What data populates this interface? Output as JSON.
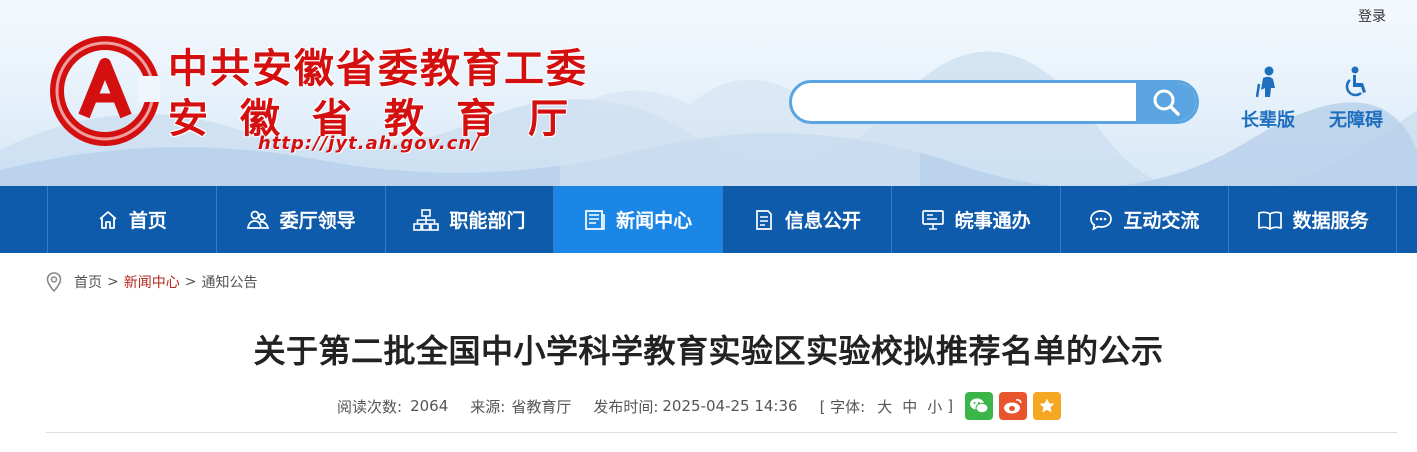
{
  "header": {
    "login_label": "登录",
    "org_name_line1": "中共安徽省委教育工委",
    "org_name_line2": "安徽省教育厅",
    "site_url": "http://jyt.ah.gov.cn/",
    "search_placeholder": "",
    "tools": [
      {
        "label": "长辈版",
        "icon": "elder-icon"
      },
      {
        "label": "无障碍",
        "icon": "wheelchair-icon"
      }
    ]
  },
  "nav": {
    "items": [
      {
        "label": "首页",
        "icon": "home-icon",
        "active": false
      },
      {
        "label": "委厅领导",
        "icon": "leaders-icon",
        "active": false
      },
      {
        "label": "职能部门",
        "icon": "org-chart-icon",
        "active": false
      },
      {
        "label": "新闻中心",
        "icon": "news-icon",
        "active": true
      },
      {
        "label": "信息公开",
        "icon": "document-icon",
        "active": false
      },
      {
        "label": "皖事通办",
        "icon": "monitor-icon",
        "active": false
      },
      {
        "label": "互动交流",
        "icon": "chat-icon",
        "active": false
      },
      {
        "label": "数据服务",
        "icon": "book-icon",
        "active": false
      }
    ]
  },
  "breadcrumb": {
    "items": [
      "首页",
      "新闻中心",
      "通知公告"
    ],
    "separator": ">"
  },
  "article": {
    "title": "关于第二批全国中小学科学教育实验区实验校拟推荐名单的公示",
    "views_label": "阅读次数:",
    "views_value": "2064",
    "source_label": "来源:",
    "source_value": "省教育厅",
    "published_label": "发布时间:",
    "published_value": "2025-04-25 14:36",
    "font_label": "[ 字体:",
    "font_sizes": [
      "大",
      "中",
      "小"
    ],
    "font_close": "]"
  },
  "colors": {
    "brand_red": "#d40f0f",
    "nav_blue": "#0e5aab",
    "nav_active": "#1c86e6",
    "search_blue": "#5aa4e2",
    "breadcrumb_active": "#b4281e"
  }
}
